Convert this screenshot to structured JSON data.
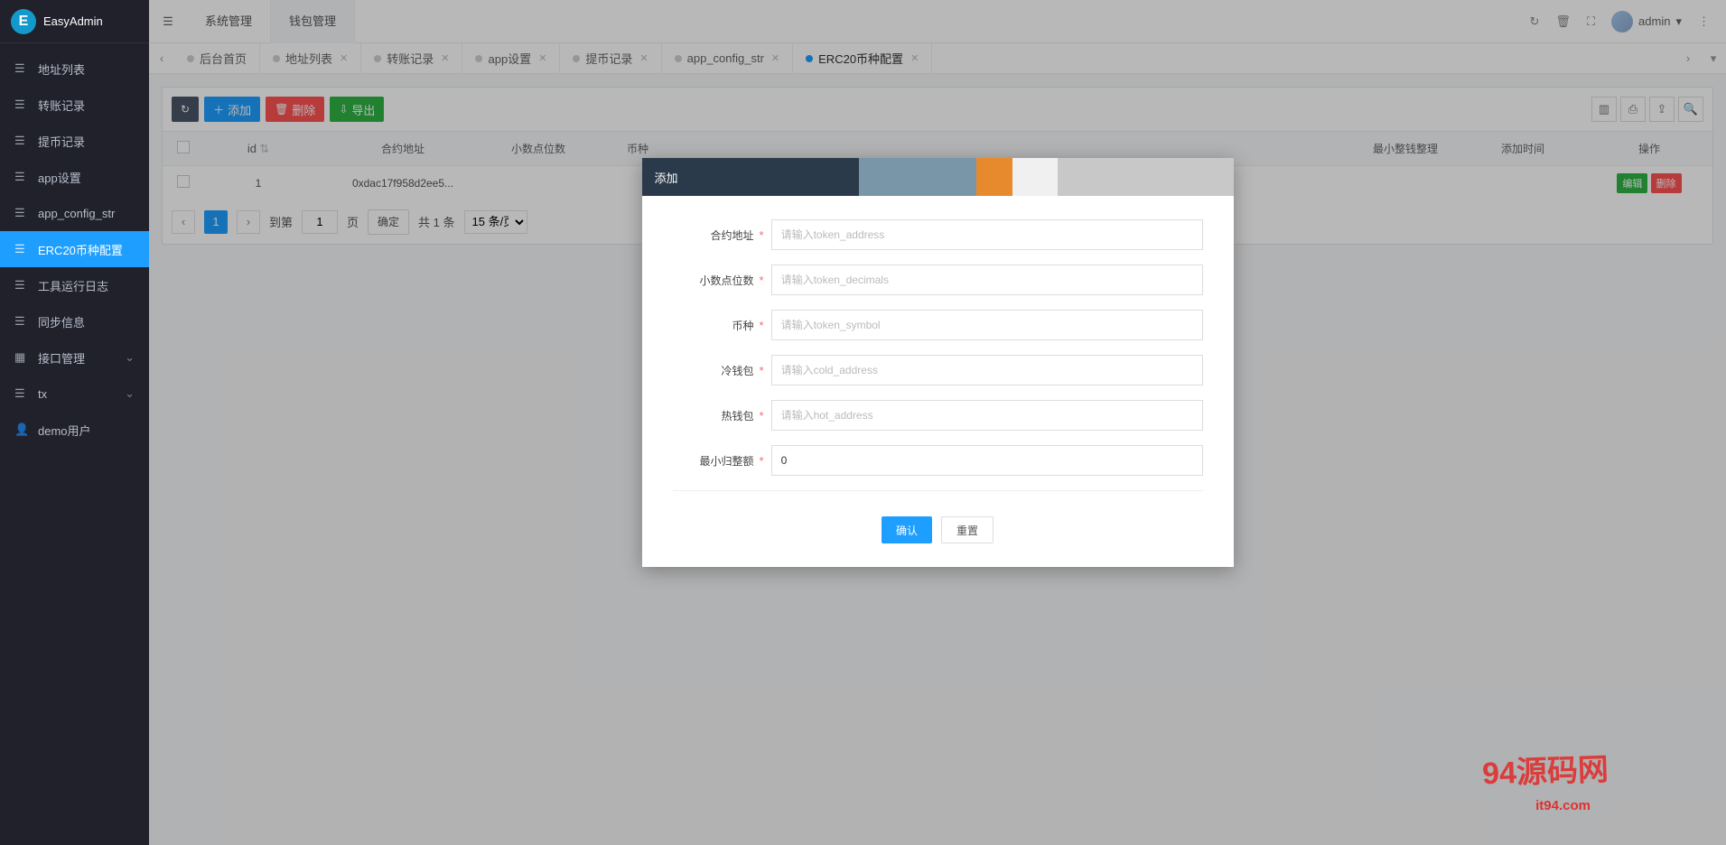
{
  "app": {
    "name": "EasyAdmin"
  },
  "header": {
    "tabs": [
      "系统管理",
      "钱包管理"
    ],
    "active_tab": 1,
    "user": "admin"
  },
  "sidebar": {
    "items": [
      {
        "label": "地址列表",
        "icon": "list"
      },
      {
        "label": "转账记录",
        "icon": "list"
      },
      {
        "label": "提币记录",
        "icon": "list"
      },
      {
        "label": "app设置",
        "icon": "list"
      },
      {
        "label": "app_config_str",
        "icon": "list"
      },
      {
        "label": "ERC20币种配置",
        "icon": "list",
        "active": true
      },
      {
        "label": "工具运行日志",
        "icon": "list"
      },
      {
        "label": "同步信息",
        "icon": "list"
      },
      {
        "label": "接口管理",
        "icon": "grid",
        "expandable": true
      },
      {
        "label": "tx",
        "icon": "list",
        "expandable": true
      },
      {
        "label": "demo用户",
        "icon": "user"
      }
    ]
  },
  "page_tabs": {
    "items": [
      {
        "label": "后台首页"
      },
      {
        "label": "地址列表"
      },
      {
        "label": "转账记录"
      },
      {
        "label": "app设置"
      },
      {
        "label": "提币记录"
      },
      {
        "label": "app_config_str"
      },
      {
        "label": "ERC20币种配置",
        "active": true
      }
    ]
  },
  "toolbar": {
    "refresh": "↻",
    "add": "添加",
    "delete": "删除",
    "export": "导出"
  },
  "table": {
    "columns": [
      "",
      "id",
      "合约地址",
      "小数点位数",
      "币种",
      "",
      "",
      "最小整钱整理",
      "添加时间",
      "操作"
    ],
    "rows": [
      {
        "id": "1",
        "address": "0xdac17f958d2ee5...",
        "edit": "编辑",
        "del": "删除"
      }
    ]
  },
  "pager": {
    "goto_label": "到第",
    "page": "1",
    "page_unit": "页",
    "confirm": "确定",
    "total": "共 1 条",
    "per_page": "15 条/页"
  },
  "modal": {
    "title": "添加",
    "fields": [
      {
        "label": "合约地址",
        "placeholder": "请输入token_address",
        "value": ""
      },
      {
        "label": "小数点位数",
        "placeholder": "请输入token_decimals",
        "value": ""
      },
      {
        "label": "币种",
        "placeholder": "请输入token_symbol",
        "value": ""
      },
      {
        "label": "冷钱包",
        "placeholder": "请输入cold_address",
        "value": ""
      },
      {
        "label": "热钱包",
        "placeholder": "请输入hot_address",
        "value": ""
      },
      {
        "label": "最小归整额",
        "placeholder": "",
        "value": "0"
      }
    ],
    "confirm": "确认",
    "reset": "重置"
  },
  "watermark": {
    "big": "94源码网",
    "small": "it94.com"
  }
}
